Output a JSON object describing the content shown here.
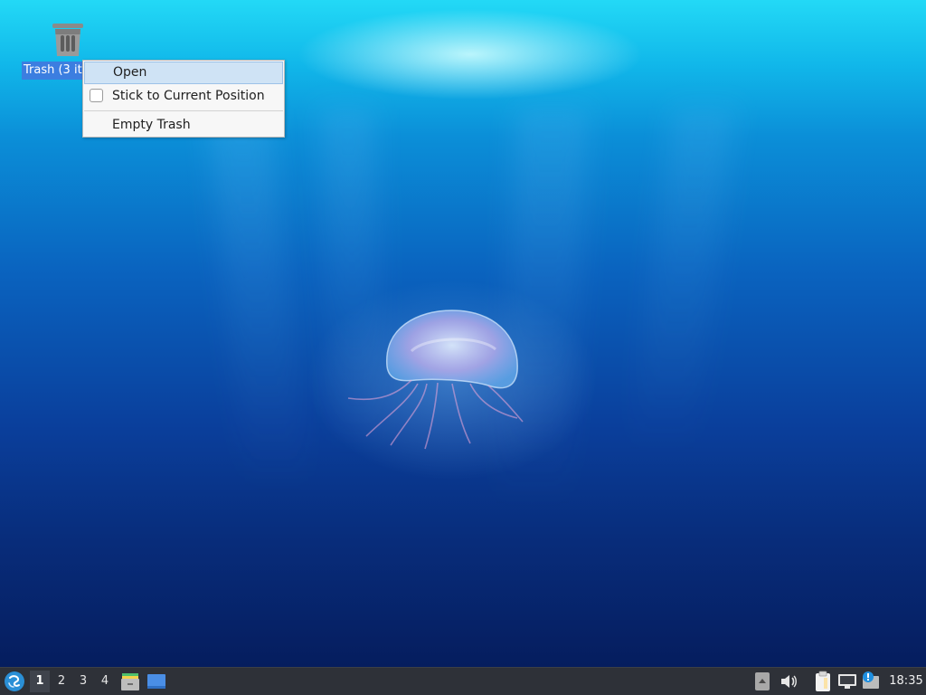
{
  "desktop": {
    "icons": [
      {
        "label": "Trash (3 it",
        "icon": "trash-icon"
      }
    ]
  },
  "context_menu": {
    "items": [
      {
        "label": "Open",
        "state": "highlighted"
      },
      {
        "label": "Stick to Current Position",
        "type": "checkbox",
        "checked": false
      },
      {
        "label": "Empty Trash"
      }
    ]
  },
  "panel": {
    "start_icon": "lxqt-menu-icon",
    "workspaces": [
      {
        "label": "1",
        "active": true
      },
      {
        "label": "2",
        "active": false
      },
      {
        "label": "3",
        "active": false
      },
      {
        "label": "4",
        "active": false
      }
    ],
    "quicklaunch": [
      "file-manager-icon",
      "show-desktop-icon"
    ],
    "tray": [
      "tray-expand-icon",
      "volume-icon",
      "clipboard-icon",
      "network-icon",
      "update-notifier-icon"
    ],
    "clock": "18:35"
  },
  "colors": {
    "selection": "#3c7ee0",
    "menu_highlight": "#cfe3f5",
    "panel_bg": "#2e3138"
  }
}
